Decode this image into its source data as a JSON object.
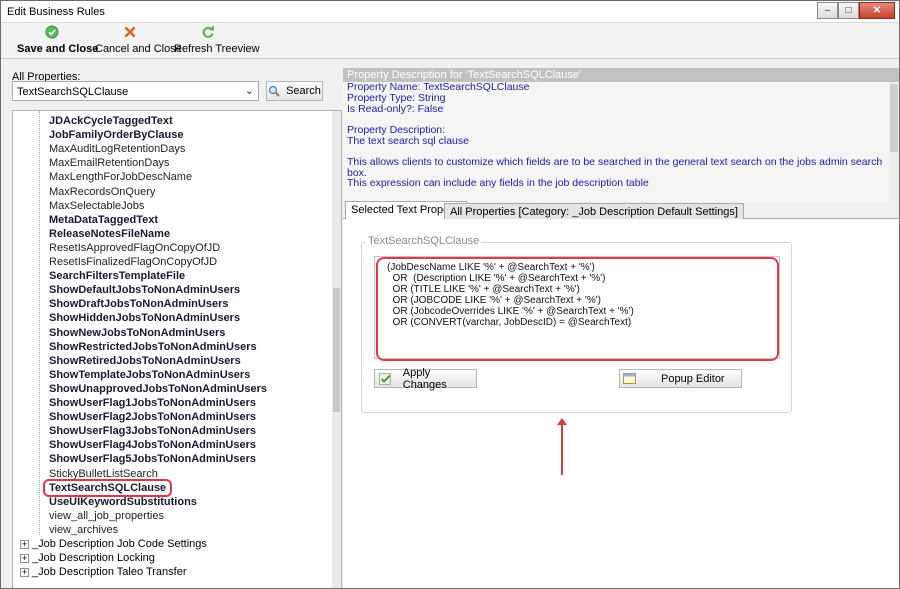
{
  "window": {
    "title": "Edit Business Rules"
  },
  "toolbar": {
    "save": "Save and Close",
    "cancel": "Cancel and Close",
    "refresh": "Refresh Treeview"
  },
  "left": {
    "all_properties_label": "All Properties:",
    "combo_value": "TextSearchSQLClause",
    "search_label": "Search",
    "tree_items": [
      {
        "label": "JDAckCycleTaggedText",
        "bold": true
      },
      {
        "label": "JobFamilyOrderByClause",
        "bold": true
      },
      {
        "label": "MaxAuditLogRetentionDays",
        "bold": false
      },
      {
        "label": "MaxEmailRetentionDays",
        "bold": false
      },
      {
        "label": "MaxLengthForJobDescName",
        "bold": false
      },
      {
        "label": "MaxRecordsOnQuery",
        "bold": false
      },
      {
        "label": "MaxSelectableJobs",
        "bold": false
      },
      {
        "label": "MetaDataTaggedText",
        "bold": true
      },
      {
        "label": "ReleaseNotesFileName",
        "bold": true
      },
      {
        "label": "ResetIsApprovedFlagOnCopyOfJD",
        "bold": false
      },
      {
        "label": "ResetIsFinalizedFlagOnCopyOfJD",
        "bold": false
      },
      {
        "label": "SearchFiltersTemplateFile",
        "bold": true
      },
      {
        "label": "ShowDefaultJobsToNonAdminUsers",
        "bold": true
      },
      {
        "label": "ShowDraftJobsToNonAdminUsers",
        "bold": true
      },
      {
        "label": "ShowHiddenJobsToNonAdminUsers",
        "bold": true
      },
      {
        "label": "ShowNewJobsToNonAdminUsers",
        "bold": true
      },
      {
        "label": "ShowRestrictedJobsToNonAdminUsers",
        "bold": true
      },
      {
        "label": "ShowRetiredJobsToNonAdminUsers",
        "bold": true
      },
      {
        "label": "ShowTemplateJobsToNonAdminUsers",
        "bold": true
      },
      {
        "label": "ShowUnapprovedJobsToNonAdminUsers",
        "bold": true
      },
      {
        "label": "ShowUserFlag1JobsToNonAdminUsers",
        "bold": true
      },
      {
        "label": "ShowUserFlag2JobsToNonAdminUsers",
        "bold": true
      },
      {
        "label": "ShowUserFlag3JobsToNonAdminUsers",
        "bold": true
      },
      {
        "label": "ShowUserFlag4JobsToNonAdminUsers",
        "bold": true
      },
      {
        "label": "ShowUserFlag5JobsToNonAdminUsers",
        "bold": true
      },
      {
        "label": "StickyBulletListSearch",
        "bold": false
      },
      {
        "label": "TextSearchSQLClause",
        "bold": true,
        "selected": true
      },
      {
        "label": "UseUIKeywordSubstitutions",
        "bold": true
      },
      {
        "label": "view_all_job_properties",
        "bold": false
      },
      {
        "label": "view_archives",
        "bold": false
      }
    ],
    "groups": [
      {
        "label": "_Job Description Job Code Settings",
        "expander": "+"
      },
      {
        "label": "_Job Description Locking",
        "expander": "+"
      },
      {
        "label": "_Job Description Taleo Transfer",
        "expander": "+"
      }
    ]
  },
  "right": {
    "desc_header": "Property Description for 'TextSearchSQLClause'",
    "desc_lines": [
      "Property Name: TextSearchSQLClause",
      "Property Type: String",
      "Is Read-only?: False",
      "",
      "Property Description:",
      "The text search sql clause",
      "",
      "This allows clients to customize which fields are to be searched in the general text search on the jobs admin search box.",
      "",
      "This expression can include any fields in the job description table"
    ],
    "tab_selected": "Selected Text Property",
    "tab_all": "All Properties [Category: _Job Description Default Settings]",
    "groupbox_label": "TextSearchSQLClause",
    "code_lines": [
      "(JobDescName LIKE '%' + @SearchText + '%')",
      "  OR  (Description LIKE '%' + @SearchText + '%')",
      "  OR (TITLE LIKE '%' + @SearchText + '%')",
      "  OR (JOBCODE LIKE '%' + @SearchText + '%')",
      "  OR (JobcodeOverrides LIKE '%' + @SearchText + '%')",
      "  OR (CONVERT(varchar, JobDescID) = @SearchText)"
    ],
    "apply_label": "Apply Changes",
    "popup_label": "Popup Editor"
  },
  "colors": {
    "highlight": "#e0374a",
    "desc_text": "#1c1ca8"
  }
}
